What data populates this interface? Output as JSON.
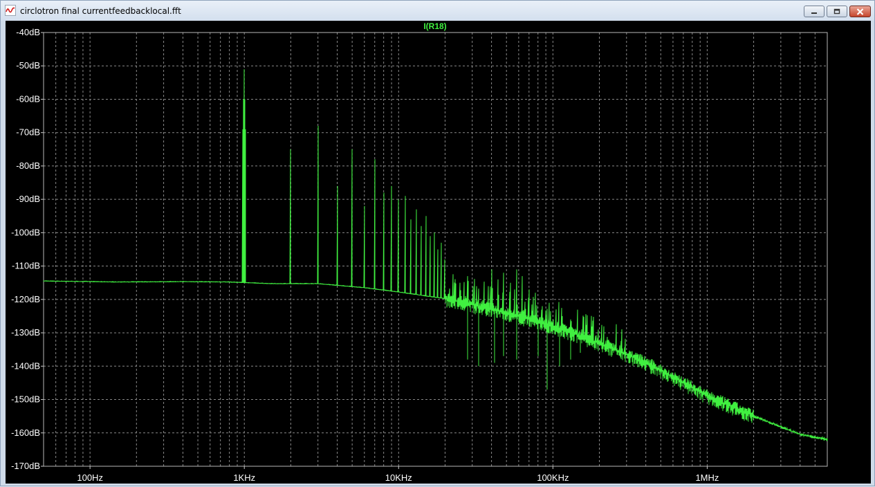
{
  "window": {
    "title": "circlotron final currentfeedbacklocal.fft"
  },
  "chart_data": {
    "type": "line",
    "title": "I(R18)",
    "xscale": "log",
    "xlim": [
      50,
      6000000
    ],
    "ylim": [
      -170,
      -40
    ],
    "grid": true,
    "x_tick_labels": [
      {
        "x": 100,
        "label": "100Hz"
      },
      {
        "x": 1000,
        "label": "1KHz"
      },
      {
        "x": 10000,
        "label": "10KHz"
      },
      {
        "x": 100000,
        "label": "100KHz"
      },
      {
        "x": 1000000,
        "label": "1MHz"
      }
    ],
    "y_tick_labels": [
      {
        "y": -40,
        "label": "-40dB"
      },
      {
        "y": -50,
        "label": "-50dB"
      },
      {
        "y": -60,
        "label": "-60dB"
      },
      {
        "y": -70,
        "label": "-70dB"
      },
      {
        "y": -80,
        "label": "-80dB"
      },
      {
        "y": -90,
        "label": "-90dB"
      },
      {
        "y": -100,
        "label": "-100dB"
      },
      {
        "y": -110,
        "label": "-110dB"
      },
      {
        "y": -120,
        "label": "-120dB"
      },
      {
        "y": -130,
        "label": "-130dB"
      },
      {
        "y": -140,
        "label": "-140dB"
      },
      {
        "y": -150,
        "label": "-150dB"
      },
      {
        "y": -160,
        "label": "-160dB"
      },
      {
        "y": -170,
        "label": "-170dB"
      }
    ],
    "series": [
      {
        "color": "#40f040",
        "noise_floor": {
          "x": [
            50,
            150,
            400,
            800,
            1500,
            3000,
            6000,
            10000,
            20000,
            40000,
            70000,
            100000,
            150000,
            250000,
            400000,
            700000,
            1000000,
            2000000,
            4000000,
            6000000
          ],
          "y": [
            -114.5,
            -114.8,
            -114.7,
            -114.8,
            -115.3,
            -115.3,
            -116.5,
            -117.8,
            -119.8,
            -123,
            -126,
            -128,
            -131,
            -135,
            -139,
            -145,
            -149,
            -155,
            -160.5,
            -162
          ]
        },
        "peaks": {
          "x": [
            1000,
            2000,
            3000,
            4000,
            5000,
            6000,
            7000,
            8000,
            9000,
            10000,
            11000,
            12000,
            13000,
            14000,
            15000,
            16000,
            17000,
            18000,
            19000,
            20000
          ],
          "y": [
            -51,
            -75,
            -68,
            -86,
            -75,
            -92,
            -78,
            -88,
            -86,
            -90,
            -89,
            -96,
            -93,
            -98,
            -95,
            -101,
            -100,
            -105,
            -103,
            -108
          ]
        },
        "hf_spurs": {
          "x": [
            25000,
            28000,
            32000,
            36000,
            40000,
            44000,
            48000,
            53000,
            58000,
            63000,
            70000,
            77000,
            85000,
            95000,
            105000,
            115000,
            130000
          ],
          "y": [
            -115,
            -113,
            -116,
            -116,
            -111,
            -114,
            -112,
            -115,
            -111,
            -113,
            -117,
            -118,
            -122,
            -121,
            -123,
            -125,
            -126
          ]
        },
        "dips": {
          "x": [
            28000,
            33000,
            42000,
            48000,
            58000,
            80000,
            92000,
            110000,
            130000,
            150000
          ],
          "y": [
            -138,
            -140,
            -139,
            -137,
            -138,
            -137,
            -147,
            -140,
            -138,
            -136
          ]
        }
      }
    ]
  }
}
